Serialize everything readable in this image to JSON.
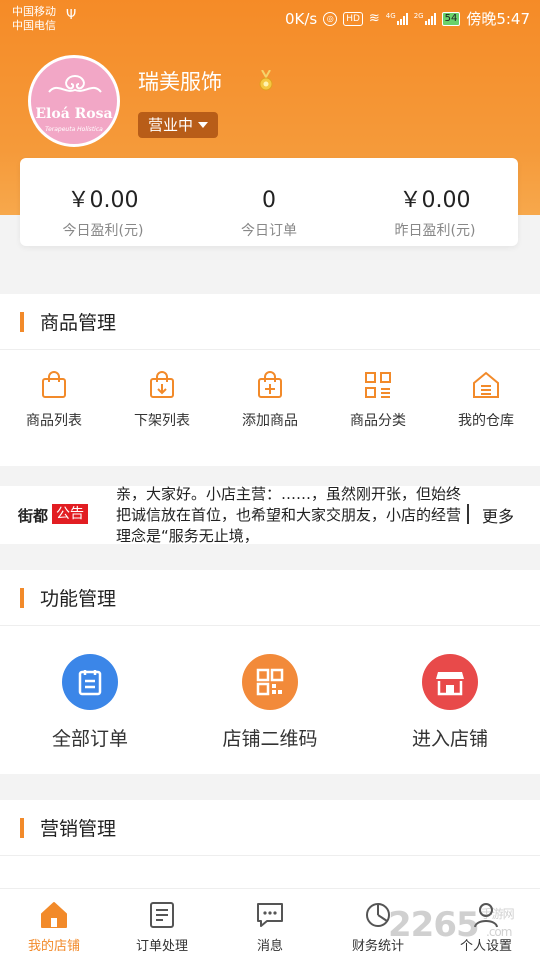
{
  "status_bar": {
    "carrier1": "中国移动",
    "carrier2": "中国电信",
    "speed": "0K/s",
    "hd": "HD",
    "net1": "4G",
    "net2": "2G",
    "battery": "54",
    "time": "傍晚5:47"
  },
  "shop": {
    "name": "瑞美服饰",
    "status": "营业中",
    "avatar_text": "Eloá Rosa",
    "avatar_sub": "Terapeuta Holística"
  },
  "stats": [
    {
      "value": "￥0.00",
      "label": "今日盈利(元)"
    },
    {
      "value": "0",
      "label": "今日订单"
    },
    {
      "value": "￥0.00",
      "label": "昨日盈利(元)"
    }
  ],
  "goods": {
    "title": "商品管理",
    "items": [
      {
        "label": "商品列表",
        "icon": "shopping-bag-icon"
      },
      {
        "label": "下架列表",
        "icon": "bag-down-icon"
      },
      {
        "label": "添加商品",
        "icon": "bag-plus-icon"
      },
      {
        "label": "商品分类",
        "icon": "category-grid-icon"
      },
      {
        "label": "我的仓库",
        "icon": "warehouse-icon"
      }
    ]
  },
  "notice": {
    "brand": "街都",
    "tag": "公告",
    "text": "亲，大家好。小店主营：……，虽然刚开张，但始终把诚信放在首位，也希望和大家交朋友，小店的经营理念是“服务无止境，",
    "more": "更多"
  },
  "functions": {
    "title": "功能管理",
    "items": [
      {
        "label": "全部订单",
        "icon": "orders-icon",
        "color": "#3b86e8"
      },
      {
        "label": "店铺二维码",
        "icon": "qrcode-icon",
        "color": "#f28a3a"
      },
      {
        "label": "进入店铺",
        "icon": "store-icon",
        "color": "#e84a4a"
      }
    ]
  },
  "marketing": {
    "title": "营销管理"
  },
  "tabbar": [
    {
      "label": "我的店铺",
      "icon": "home-icon",
      "active": true
    },
    {
      "label": "订单处理",
      "icon": "order-list-icon"
    },
    {
      "label": "消息",
      "icon": "message-icon"
    },
    {
      "label": "财务统计",
      "icon": "finance-icon"
    },
    {
      "label": "个人设置",
      "icon": "user-icon"
    }
  ],
  "watermark": {
    "main": "2265",
    "sub": "手游网",
    "domain": ".com"
  },
  "colors": {
    "accent": "#f28a2a",
    "header": "#f58b27",
    "notice_tag": "#e21d22"
  }
}
